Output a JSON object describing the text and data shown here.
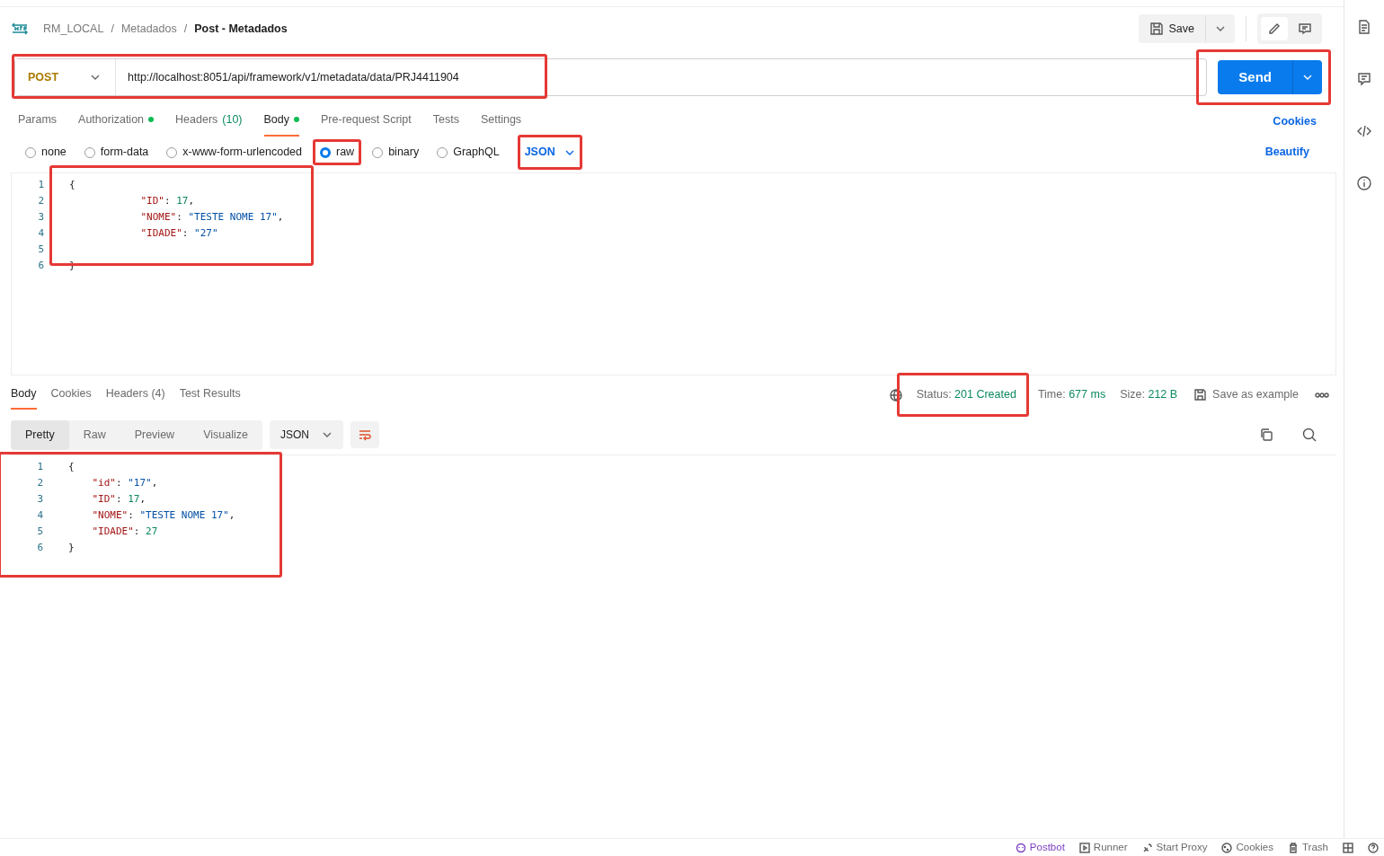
{
  "breadcrumb": {
    "items": [
      {
        "label": "RM_LOCAL",
        "separator": "/"
      },
      {
        "label": "Metadados",
        "separator": "/"
      }
    ],
    "current": "Post - Metadados"
  },
  "actions": {
    "save": "Save"
  },
  "request": {
    "method": "POST",
    "url": "http://localhost:8051/api/framework/v1/metadata/data/PRJ4411904",
    "highlighted": true,
    "send": "Send",
    "send_highlighted": true
  },
  "tabs": [
    {
      "label": "Params",
      "dot": false,
      "selected": false
    },
    {
      "label": "Authorization",
      "dot": true,
      "selected": false
    },
    {
      "label": "Headers",
      "count": "(10)",
      "dot": false,
      "selected": false
    },
    {
      "label": "Body",
      "dot": true,
      "selected": true
    },
    {
      "label": "Pre-request Script",
      "dot": false,
      "selected": false
    },
    {
      "label": "Tests",
      "dot": false,
      "selected": false
    },
    {
      "label": "Settings",
      "dot": false,
      "selected": false
    }
  ],
  "cookies_link": "Cookies",
  "body_types": [
    {
      "label": "none",
      "selected": false,
      "highlighted": false
    },
    {
      "label": "form-data",
      "selected": false,
      "highlighted": false
    },
    {
      "label": "x-www-form-urlencoded",
      "selected": false,
      "highlighted": false
    },
    {
      "label": "raw",
      "selected": true,
      "highlighted": true
    },
    {
      "label": "binary",
      "selected": false,
      "highlighted": false
    },
    {
      "label": "GraphQL",
      "selected": false,
      "highlighted": false
    }
  ],
  "body_format": {
    "value": "JSON",
    "highlighted": true
  },
  "beautify": "Beautify",
  "request_body": {
    "highlighted": true,
    "lines": [
      {
        "number": "1",
        "text": "{"
      },
      {
        "number": "2",
        "text": "            \"ID\": 17,"
      },
      {
        "number": "3",
        "text": "            \"NOME\": \"TESTE NOME 17\","
      },
      {
        "number": "4",
        "text": "            \"IDADE\": \"27\""
      },
      {
        "number": "5"
      },
      {
        "number": "6",
        "text": "}"
      }
    ]
  },
  "response_tabs": [
    {
      "label": "Body",
      "selected": true
    },
    {
      "label": "Cookies",
      "selected": false
    },
    {
      "label": "Headers (4)",
      "selected": false
    },
    {
      "label": "Test Results",
      "selected": false
    }
  ],
  "response_meta": [
    {
      "label": "Status:",
      "value": "201 Created",
      "highlighted": true
    },
    {
      "label": "Time:",
      "value": "677 ms",
      "highlighted": false
    },
    {
      "label": "Size:",
      "value": "212 B",
      "highlighted": false
    }
  ],
  "save_example": "Save as example",
  "view_modes": [
    {
      "label": "Pretty",
      "selected": true
    },
    {
      "label": "Raw",
      "selected": false
    },
    {
      "label": "Preview",
      "selected": false
    },
    {
      "label": "Visualize",
      "selected": false
    }
  ],
  "response_format": "JSON",
  "response_body": {
    "highlighted": true,
    "lines": [
      {
        "number": "1",
        "text": "{"
      },
      {
        "number": "2",
        "text": "    \"id\": \"17\","
      },
      {
        "number": "3",
        "text": "    \"ID\": 17,"
      },
      {
        "number": "4",
        "text": "    \"NOME\": \"TESTE NOME 17\","
      },
      {
        "number": "5",
        "text": "    \"IDADE\": 27"
      },
      {
        "number": "6",
        "text": "}"
      }
    ]
  },
  "footer": [
    "Postbot",
    "Runner",
    "Start Proxy",
    "Cookies",
    "Trash"
  ]
}
